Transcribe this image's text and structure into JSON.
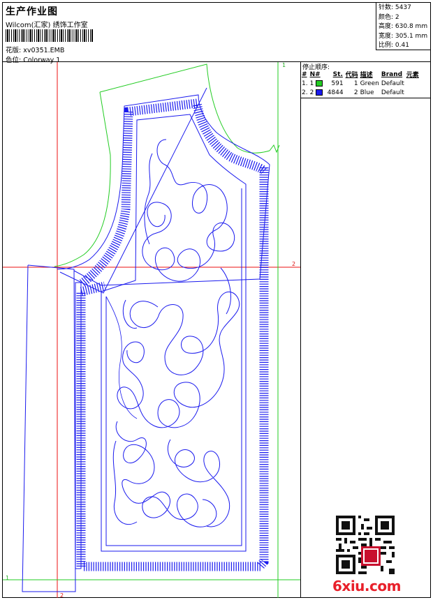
{
  "header": {
    "title": "生产作业图",
    "company": "Wilcom(汇家) 绣饰工作室",
    "design_label": "花版:",
    "design_file": "xv0351.EMB",
    "colorway_label": "色位:",
    "colorway": "Colorway 1"
  },
  "stats": {
    "stitches_label": "针数:",
    "stitches": "5437",
    "colors_label": "颜色:",
    "colors": "2",
    "height_label": "高度:",
    "height": "630.8 mm",
    "width_label": "宽度:",
    "width": "305.1 mm",
    "scale_label": "比例:",
    "scale": "0.41"
  },
  "stop_sequence": {
    "title": "停止顺序:",
    "headers": [
      "#",
      "N#",
      "St.",
      "代码",
      "描述",
      "Brand",
      "元素"
    ],
    "rows": [
      {
        "num": "1.",
        "n": "1",
        "color": "#22cc22",
        "st": "591",
        "code": "1",
        "desc": "Green",
        "brand": "Default"
      },
      {
        "num": "2.",
        "n": "2",
        "color": "#1a1aee",
        "st": "4844",
        "code": "2",
        "desc": "Blue",
        "brand": "Default"
      }
    ]
  },
  "guides": {
    "v1": "1",
    "h2": "2",
    "h1": "1",
    "v2": "2"
  },
  "watermark": {
    "site": "6xiu.com"
  },
  "colors": {
    "green": "#22cc22",
    "blue": "#1a1aee",
    "red": "#ee1111"
  }
}
